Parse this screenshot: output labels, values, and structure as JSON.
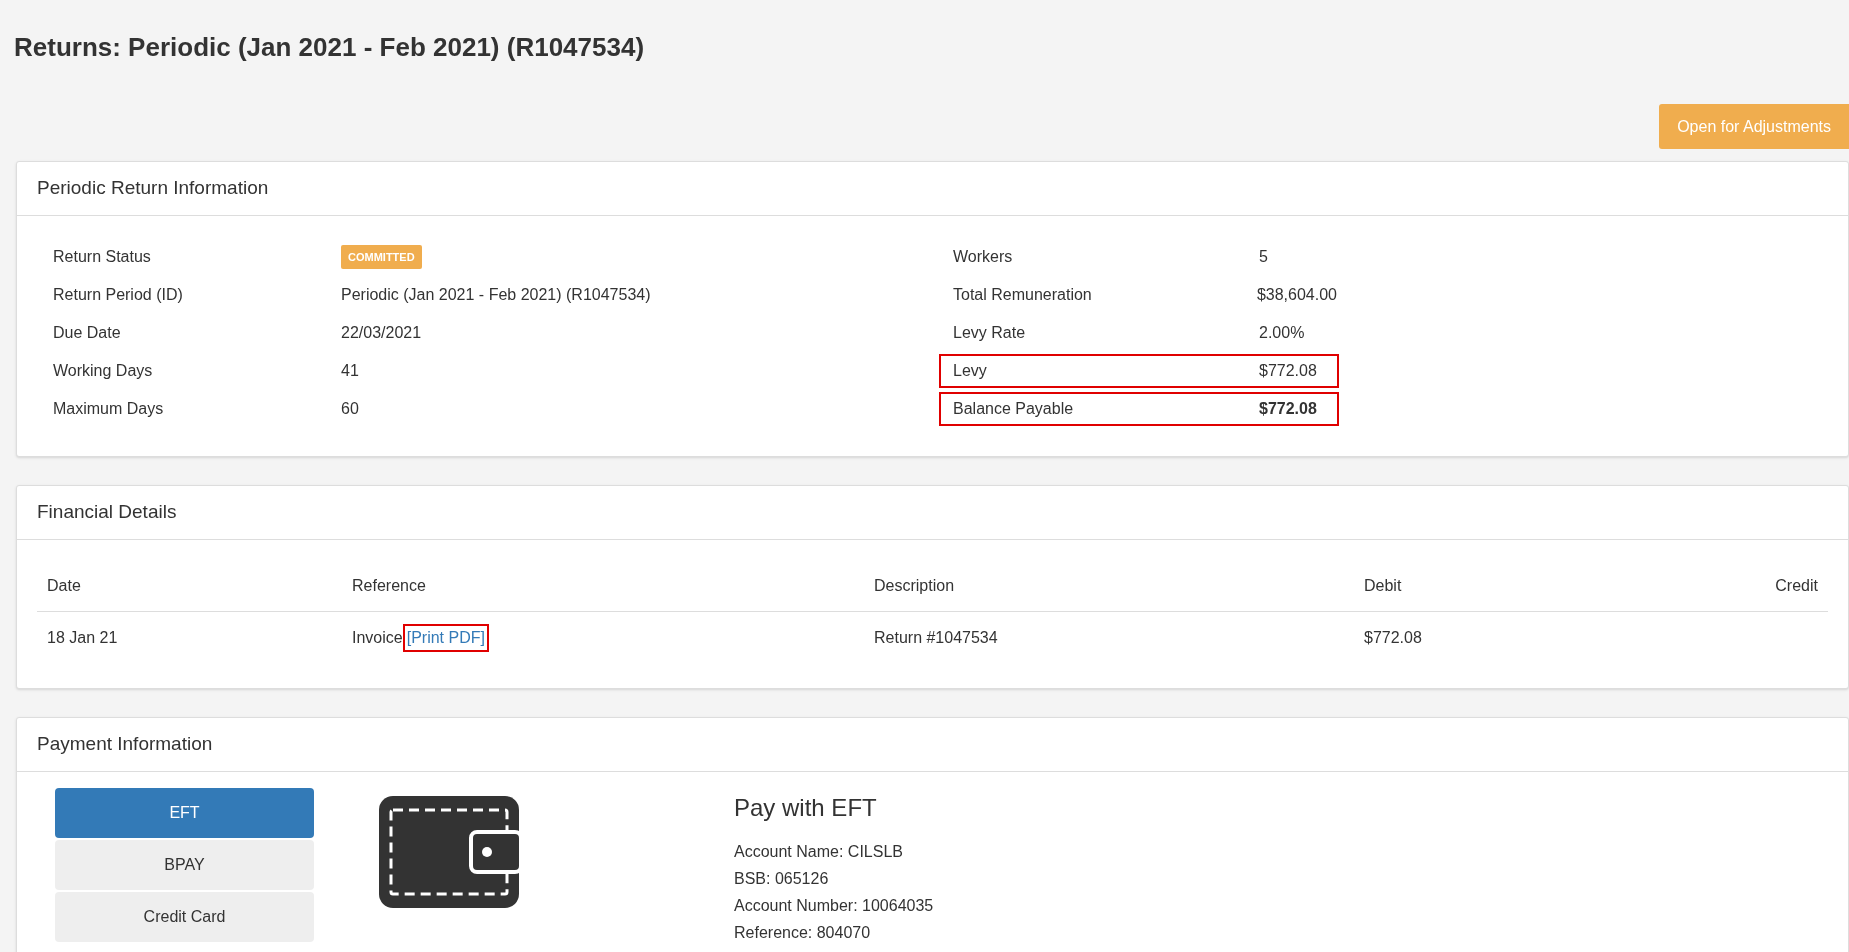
{
  "page_title": "Returns: Periodic (Jan 2021 - Feb 2021) (R1047534)",
  "action_button": "Open for Adjustments",
  "return_info": {
    "title": "Periodic Return Information",
    "left": [
      {
        "label": "Return Status",
        "value": "COMMITTED",
        "kind": "badge"
      },
      {
        "label": "Return Period (ID)",
        "value": "Periodic (Jan 2021 - Feb 2021) (R1047534)",
        "kind": "text"
      },
      {
        "label": "Due Date",
        "value": "22/03/2021",
        "kind": "text"
      },
      {
        "label": "Working Days",
        "value": "41",
        "kind": "text"
      },
      {
        "label": "Maximum Days",
        "value": "60",
        "kind": "text"
      }
    ],
    "right": [
      {
        "label": "Workers",
        "value": "5",
        "highlighted": false,
        "bold": false
      },
      {
        "label": "Total Remuneration",
        "value": "$38,604.00",
        "highlighted": false,
        "bold": false
      },
      {
        "label": "Levy Rate",
        "value": "2.00%",
        "highlighted": false,
        "bold": false
      },
      {
        "label": "Levy",
        "value": "$772.08",
        "highlighted": true,
        "bold": false
      },
      {
        "label": "Balance Payable",
        "value": "$772.08",
        "highlighted": true,
        "bold": true
      }
    ]
  },
  "financial": {
    "title": "Financial Details",
    "columns": [
      "Date",
      "Reference",
      "Description",
      "Debit",
      "Credit"
    ],
    "rows": [
      {
        "date": "18 Jan 21",
        "reference": "Invoice",
        "link": "[Print PDF]",
        "link_highlighted": true,
        "description": "Return #1047534",
        "debit": "$772.08"
      }
    ]
  },
  "payment": {
    "title": "Payment Information",
    "methods": [
      {
        "label": "EFT",
        "selected": true
      },
      {
        "label": "BPAY",
        "selected": false
      },
      {
        "label": "Credit Card",
        "selected": false
      }
    ],
    "heading": "Pay with EFT",
    "lines": [
      "Account Name: CILSLB",
      "BSB: 065126",
      "Account Number: 10064035",
      "Reference: 804070"
    ]
  }
}
